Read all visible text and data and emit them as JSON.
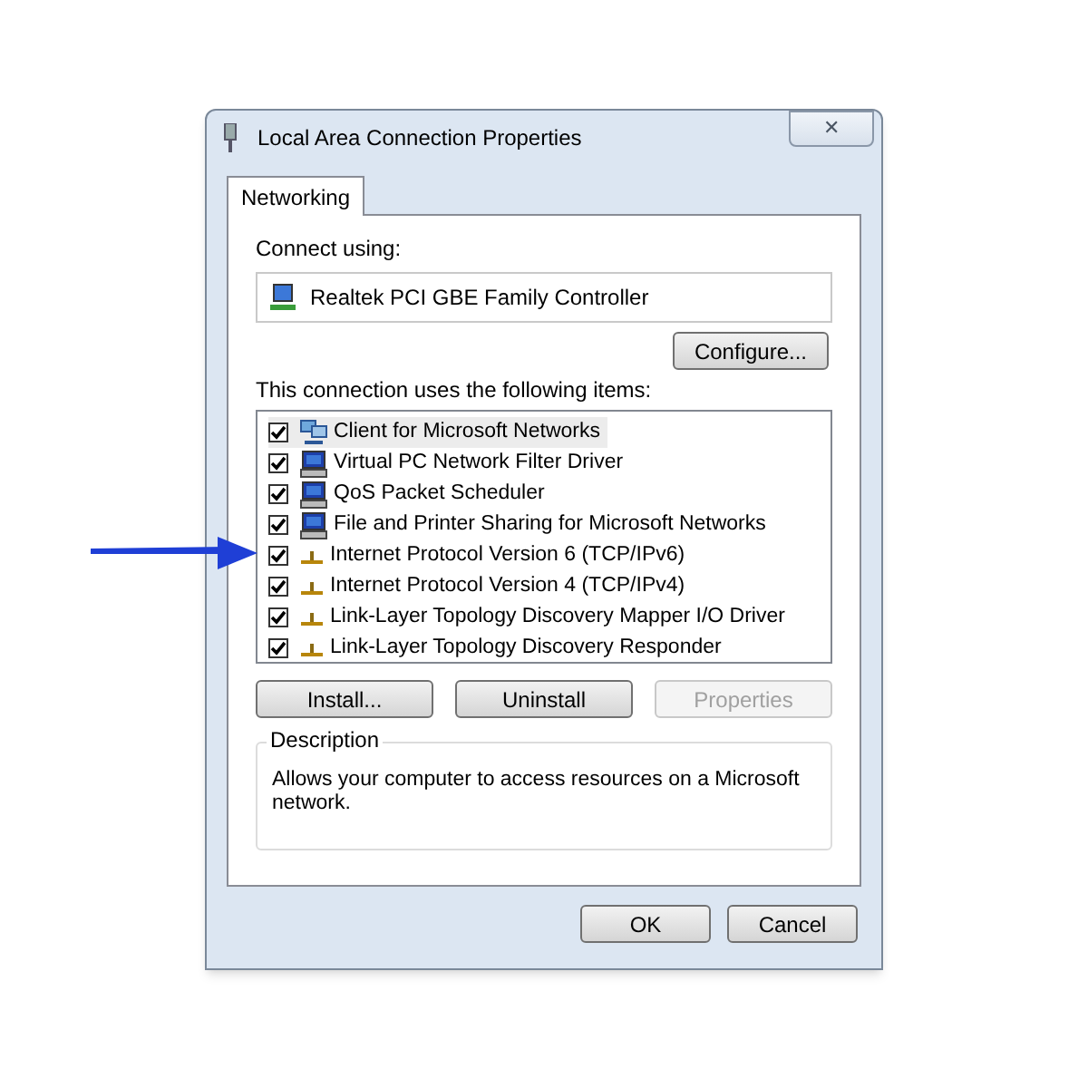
{
  "window": {
    "title": "Local Area Connection Properties",
    "close": "✕"
  },
  "tabs": [
    {
      "label": "Networking",
      "selected": true
    }
  ],
  "connect_using": {
    "label": "Connect using:",
    "adapter": "Realtek PCI GBE Family Controller",
    "configure_button": "Configure..."
  },
  "items_label": "This connection uses the following items:",
  "items": [
    {
      "kind": "client",
      "label": "Client for Microsoft Networks",
      "checked": true,
      "selected": true
    },
    {
      "kind": "service",
      "label": "Virtual PC Network Filter Driver",
      "checked": true,
      "selected": false
    },
    {
      "kind": "service",
      "label": "QoS Packet Scheduler",
      "checked": true,
      "selected": false
    },
    {
      "kind": "service",
      "label": "File and Printer Sharing for Microsoft Networks",
      "checked": true,
      "selected": false
    },
    {
      "kind": "protocol",
      "label": "Internet Protocol Version 6 (TCP/IPv6)",
      "checked": true,
      "selected": false
    },
    {
      "kind": "protocol",
      "label": "Internet Protocol Version 4 (TCP/IPv4)",
      "checked": true,
      "selected": false
    },
    {
      "kind": "protocol",
      "label": "Link-Layer Topology Discovery Mapper I/O Driver",
      "checked": true,
      "selected": false
    },
    {
      "kind": "protocol",
      "label": "Link-Layer Topology Discovery Responder",
      "checked": true,
      "selected": false
    }
  ],
  "item_buttons": [
    {
      "label": "Install...",
      "disabled": false
    },
    {
      "label": "Uninstall",
      "disabled": false
    },
    {
      "label": "Properties",
      "disabled": true
    }
  ],
  "description": {
    "title": "Description",
    "text": "Allows your computer to access resources on a Microsoft network."
  },
  "dialog_buttons": [
    "OK",
    "Cancel"
  ]
}
